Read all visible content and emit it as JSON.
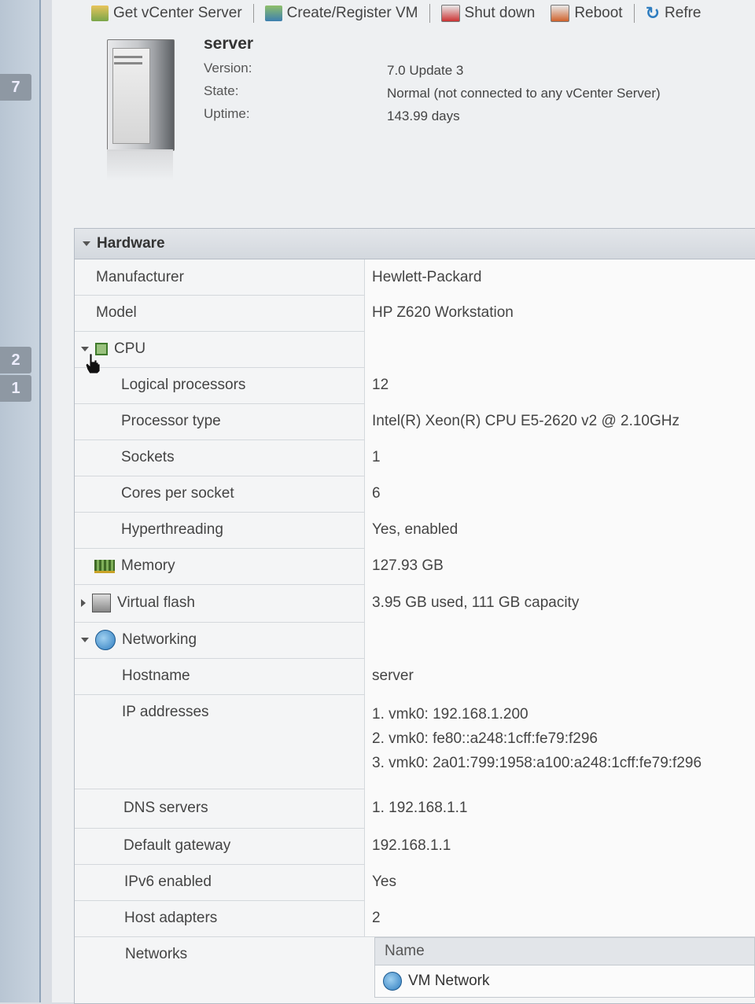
{
  "toolbar": {
    "items": [
      {
        "label": "Get vCenter Server",
        "icon": "vcenter-icon"
      },
      {
        "label": "Create/Register VM",
        "icon": "create-vm-icon"
      },
      {
        "label": "Shut down",
        "icon": "shutdown-icon"
      },
      {
        "label": "Reboot",
        "icon": "reboot-icon"
      },
      {
        "label": "Refre",
        "icon": "refresh-icon"
      }
    ]
  },
  "sidebar": {
    "badges": [
      "7",
      "2",
      "1"
    ]
  },
  "host": {
    "name": "server",
    "version_label": "Version:",
    "version_value": "7.0 Update 3",
    "state_label": "State:",
    "state_value": "Normal (not connected to any vCenter Server)",
    "uptime_label": "Uptime:",
    "uptime_value": "143.99 days"
  },
  "hardware": {
    "title": "Hardware",
    "manufacturer_label": "Manufacturer",
    "manufacturer_value": "Hewlett-Packard",
    "model_label": "Model",
    "model_value": "HP Z620 Workstation",
    "cpu": {
      "label": "CPU",
      "logical_label": "Logical processors",
      "logical_value": "12",
      "type_label": "Processor type",
      "type_value": "Intel(R) Xeon(R) CPU E5-2620 v2 @ 2.10GHz",
      "sockets_label": "Sockets",
      "sockets_value": "1",
      "cores_label": "Cores per socket",
      "cores_value": "6",
      "ht_label": "Hyperthreading",
      "ht_value": "Yes, enabled"
    },
    "memory_label": "Memory",
    "memory_value": "127.93 GB",
    "flash_label": "Virtual flash",
    "flash_value": "3.95 GB used, 111 GB capacity",
    "networking": {
      "label": "Networking",
      "hostname_label": "Hostname",
      "hostname_value": "server",
      "ip_label": "IP addresses",
      "ip_values": [
        "1. vmk0: 192.168.1.200",
        "2. vmk0: fe80::a248:1cff:fe79:f296",
        "3. vmk0: 2a01:799:1958:a100:a248:1cff:fe79:f296"
      ],
      "dns_label": "DNS servers",
      "dns_value": "1. 192.168.1.1",
      "gateway_label": "Default gateway",
      "gateway_value": "192.168.1.1",
      "ipv6_label": "IPv6 enabled",
      "ipv6_value": "Yes",
      "adapters_label": "Host adapters",
      "adapters_value": "2",
      "networks_label": "Networks",
      "networks_table": {
        "column_name": "Name",
        "rows": [
          "VM Network"
        ]
      }
    }
  },
  "colors": {
    "accent": "#2f7dc0",
    "panel_header": "#d8dce1",
    "sidebar": "#b8c5d3"
  }
}
